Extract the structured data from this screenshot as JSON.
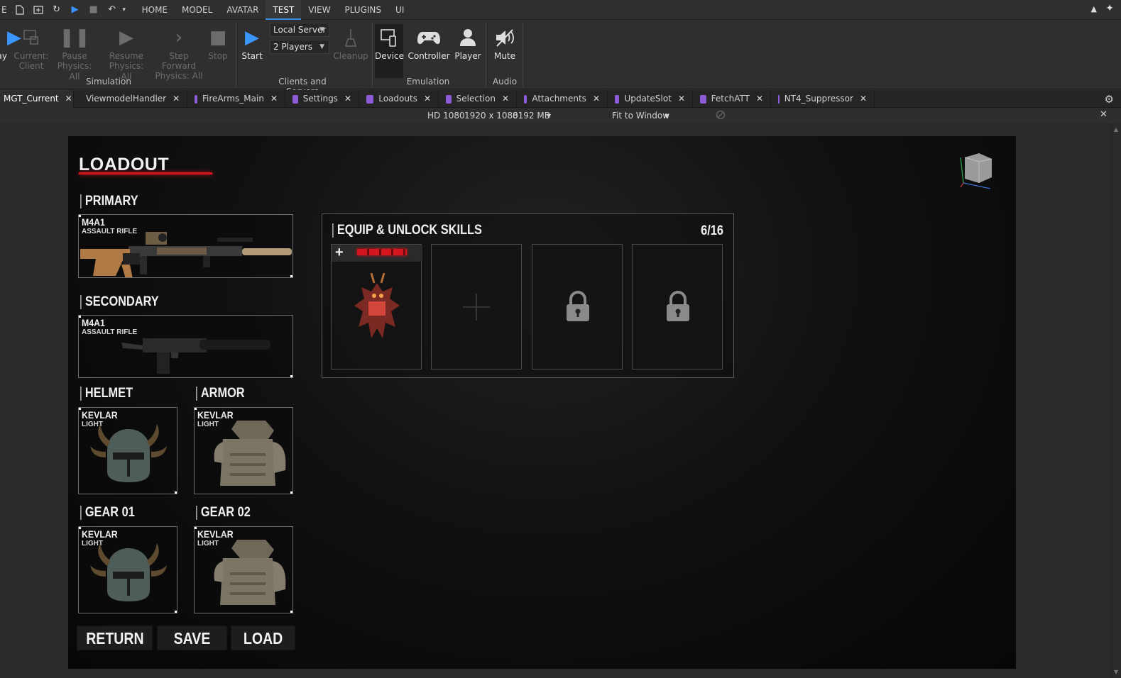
{
  "top_menu": {
    "left_edge": "E",
    "tabs": [
      "HOME",
      "MODEL",
      "AVATAR",
      "TEST",
      "VIEW",
      "PLUGINS",
      "UI"
    ],
    "active_tab": "TEST"
  },
  "ribbon": {
    "play_partial": "ay",
    "current_client": "Current:",
    "current_client_sub": "Client",
    "pause": "Pause",
    "pause_sub": "Physics: All",
    "resume": "Resume",
    "resume_sub": "Physics: All",
    "step_forward": "Step Forward",
    "step_forward_sub": "Physics: All",
    "stop": "Stop",
    "simulation_label": "Simulation",
    "start": "Start",
    "server_select": "Local Server",
    "players_select": "2 Players",
    "cleanup": "Cleanup",
    "clients_label": "Clients and Servers",
    "device": "Device",
    "controller": "Controller",
    "player": "Player",
    "emulation_label": "Emulation",
    "mute": "Mute",
    "audio_label": "Audio"
  },
  "doc_tabs": [
    {
      "label": "MGT_Current",
      "script": false
    },
    {
      "label": "ViewmodelHandler",
      "script": true
    },
    {
      "label": "FireArms_Main",
      "script": true
    },
    {
      "label": "Settings",
      "script": true
    },
    {
      "label": "Loadouts",
      "script": true
    },
    {
      "label": "Selection",
      "script": true
    },
    {
      "label": "Attachments",
      "script": true
    },
    {
      "label": "UpdateSlot",
      "script": true
    },
    {
      "label": "FetchATT",
      "script": true
    },
    {
      "label": "NT4_Suppressor",
      "script": true
    }
  ],
  "viewbar": {
    "device": "HD 1080",
    "resolution": "1920 x 1080",
    "memory": "8192 MB",
    "fit": "Fit to Window"
  },
  "game": {
    "title": "LOADOUT",
    "primary": {
      "label": "PRIMARY",
      "name": "M4A1",
      "type": "ASSAULT RIFLE"
    },
    "secondary": {
      "label": "SECONDARY",
      "name": "M4A1",
      "type": "ASSAULT RIFLE"
    },
    "helmet": {
      "label": "HELMET",
      "name": "KEVLAR",
      "type": "LIGHT"
    },
    "armor": {
      "label": "ARMOR",
      "name": "KEVLAR",
      "type": "LIGHT"
    },
    "gear1": {
      "label": "GEAR 01",
      "name": "KEVLAR",
      "type": "LIGHT"
    },
    "gear2": {
      "label": "GEAR 02",
      "name": "KEVLAR",
      "type": "LIGHT"
    },
    "skills": {
      "title": "EQUIP & UNLOCK SKILLS",
      "count": "6/16"
    },
    "buttons": {
      "return": "RETURN",
      "save": "SAVE",
      "load": "LOAD"
    },
    "accent": "#d6161f"
  }
}
